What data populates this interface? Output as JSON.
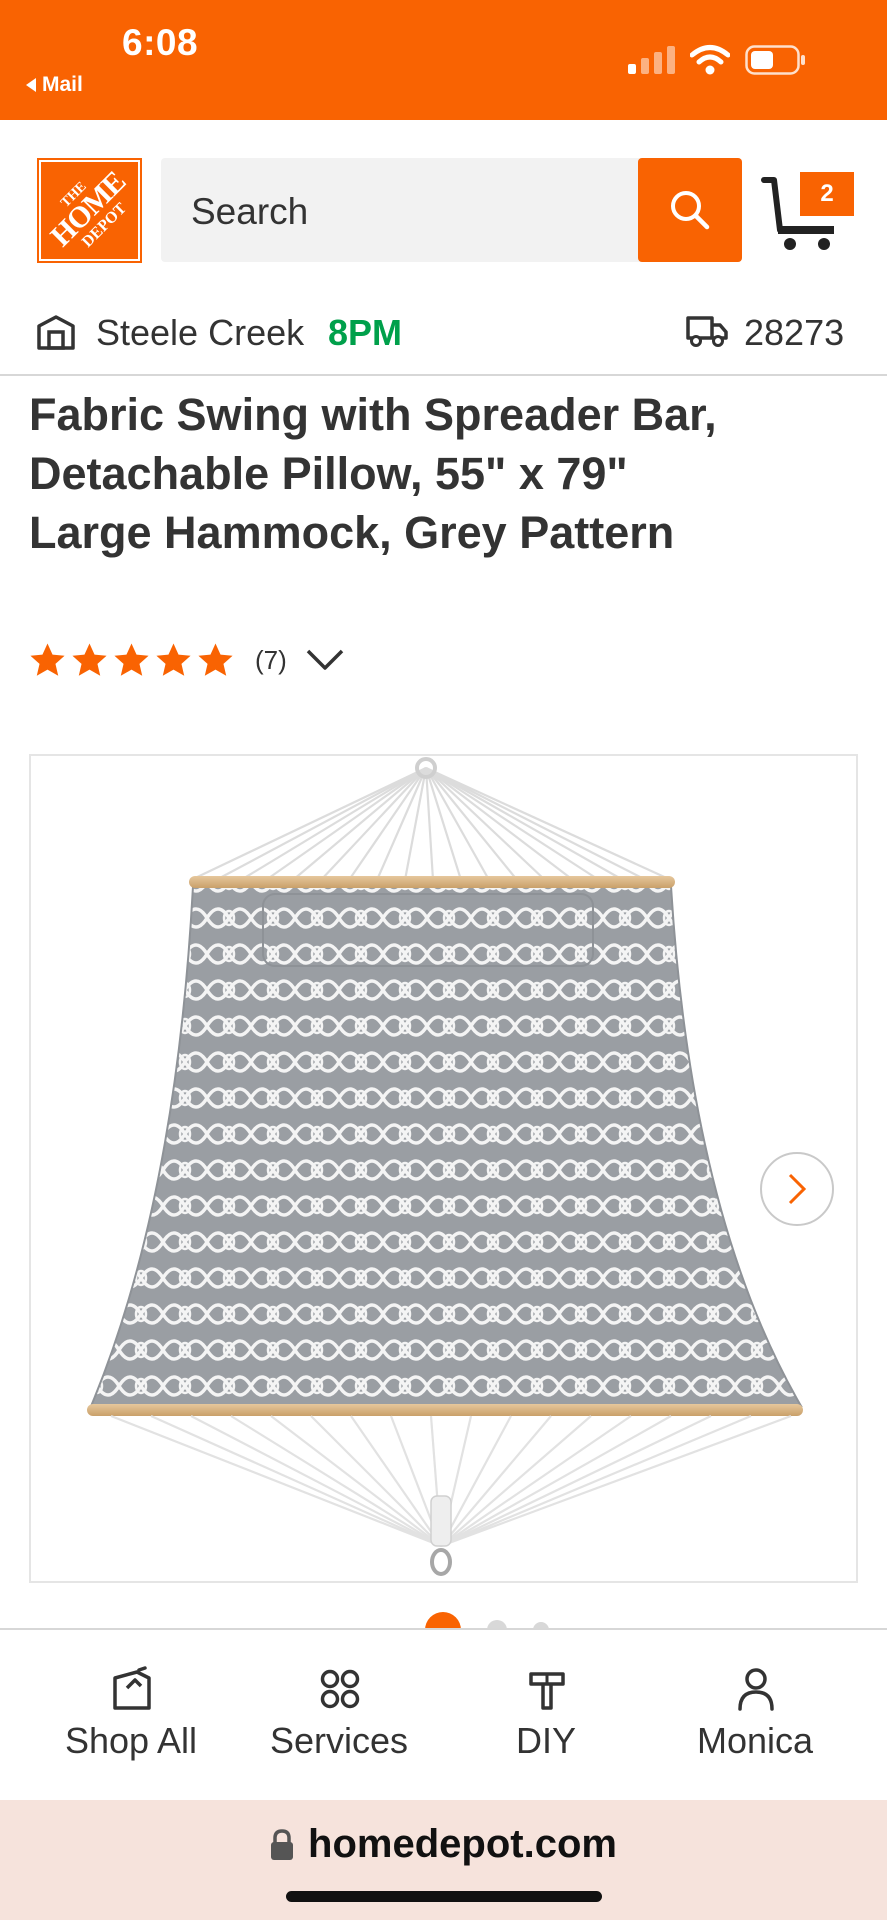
{
  "status_bar": {
    "time": "6:08",
    "back_app": "Mail"
  },
  "colors": {
    "brand_orange": "#f96302",
    "store_hours_green": "#00a04b"
  },
  "header": {
    "logo": {
      "line1": "THE",
      "line2": "HOME",
      "line3": "DEPOT"
    },
    "search_placeholder": "Search",
    "cart_count": "2",
    "store_name": "Steele Creek",
    "store_hours": "8PM",
    "zip_code": "28273"
  },
  "product": {
    "title": "Fabric Swing with Spreader Bar, Detachable Pillow, 55\" x 79\" Large Hammock, Grey Pattern",
    "rating_stars": 5,
    "review_count": "(7)"
  },
  "gallery": {
    "image_icon": "hammock-image",
    "dots": 3,
    "active_dot": 0
  },
  "bottom_nav": {
    "items": [
      {
        "label": "Shop All",
        "icon": "shop-all-icon"
      },
      {
        "label": "Services",
        "icon": "services-icon"
      },
      {
        "label": "DIY",
        "icon": "diy-icon"
      },
      {
        "label": "Monica",
        "icon": "account-icon"
      }
    ]
  },
  "url_bar": {
    "domain": "homedepot.com"
  }
}
